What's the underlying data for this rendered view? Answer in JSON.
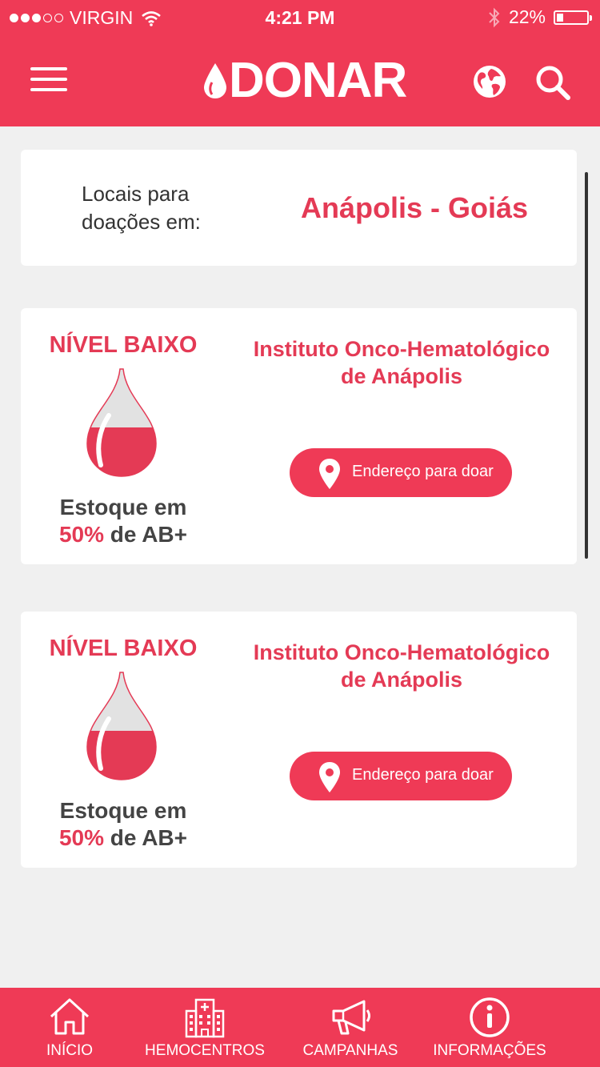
{
  "status_bar": {
    "carrier": "VIRGIN",
    "time": "4:21 PM",
    "battery": "22%",
    "battery_level": 0.22
  },
  "header": {
    "logo_text": "DONAR"
  },
  "location": {
    "label": "Locais para doações em:",
    "city": "Anápolis - Goiás"
  },
  "centers": [
    {
      "level": "NÍVEL BAIXO",
      "stock_line1": "Estoque em",
      "stock_pct": "50%",
      "stock_line2": " de AB+",
      "stock_fraction": 0.5,
      "name": "Instituto Onco-Hematológico de Anápolis",
      "address_button": "Endereço para doar"
    },
    {
      "level": "NÍVEL BAIXO",
      "stock_line1": "Estoque em",
      "stock_pct": "50%",
      "stock_line2": " de AB+",
      "stock_fraction": 0.5,
      "name": "Instituto Onco-Hematológico de Anápolis",
      "address_button": "Endereço para doar"
    }
  ],
  "tabs": [
    {
      "label": "INÍCIO",
      "icon": "home-icon"
    },
    {
      "label": "HEMOCENTROS",
      "icon": "hospital-icon"
    },
    {
      "label": "CAMPANHAS",
      "icon": "megaphone-icon"
    },
    {
      "label": "INFORMAÇÕES",
      "icon": "info-icon"
    }
  ],
  "colors": {
    "brand": "#ef3a56",
    "accent_text": "#e43a55",
    "background": "#f0f0f0"
  }
}
